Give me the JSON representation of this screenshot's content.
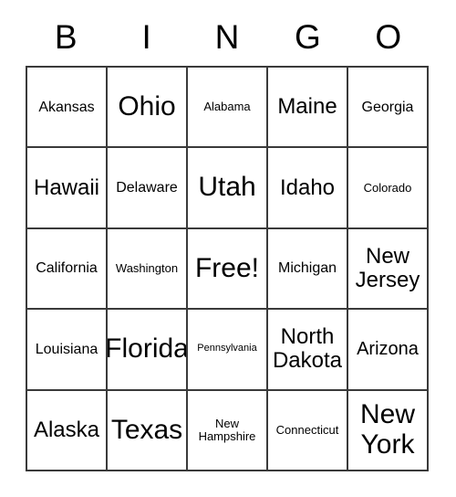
{
  "card": {
    "title": "BINGO card",
    "header_letters": [
      "B",
      "I",
      "N",
      "G",
      "O"
    ],
    "free_space_label": "Free!",
    "colors": {
      "text": "#000000",
      "border": "#3a3a3a",
      "background": "#ffffff"
    },
    "rows": [
      [
        {
          "label": "Akansas",
          "size": "s-md"
        },
        {
          "label": "Ohio",
          "size": "s-xxl"
        },
        {
          "label": "Alabama",
          "size": "s-sm"
        },
        {
          "label": "Maine",
          "size": "s-xl"
        },
        {
          "label": "Georgia",
          "size": "s-md"
        }
      ],
      [
        {
          "label": "Hawaii",
          "size": "s-xl"
        },
        {
          "label": "Delaware",
          "size": "s-md"
        },
        {
          "label": "Utah",
          "size": "s-xxl"
        },
        {
          "label": "Idaho",
          "size": "s-xl"
        },
        {
          "label": "Colorado",
          "size": "s-sm"
        }
      ],
      [
        {
          "label": "California",
          "size": "s-md"
        },
        {
          "label": "Washington",
          "size": "s-sm"
        },
        {
          "label": "Free!",
          "size": "s-xxl"
        },
        {
          "label": "Michigan",
          "size": "s-md"
        },
        {
          "label": "New Jersey",
          "size": "s-xl"
        }
      ],
      [
        {
          "label": "Louisiana",
          "size": "s-md"
        },
        {
          "label": "Florida",
          "size": "s-xxl"
        },
        {
          "label": "Pennsylvania",
          "size": "s-xs"
        },
        {
          "label": "North Dakota",
          "size": "s-xl"
        },
        {
          "label": "Arizona",
          "size": "s-lg"
        }
      ],
      [
        {
          "label": "Alaska",
          "size": "s-xl"
        },
        {
          "label": "Texas",
          "size": "s-xxl"
        },
        {
          "label": "New Hampshire",
          "size": "s-sm"
        },
        {
          "label": "Connecticut",
          "size": "s-sm"
        },
        {
          "label": "New York",
          "size": "s-xxl"
        }
      ]
    ]
  }
}
